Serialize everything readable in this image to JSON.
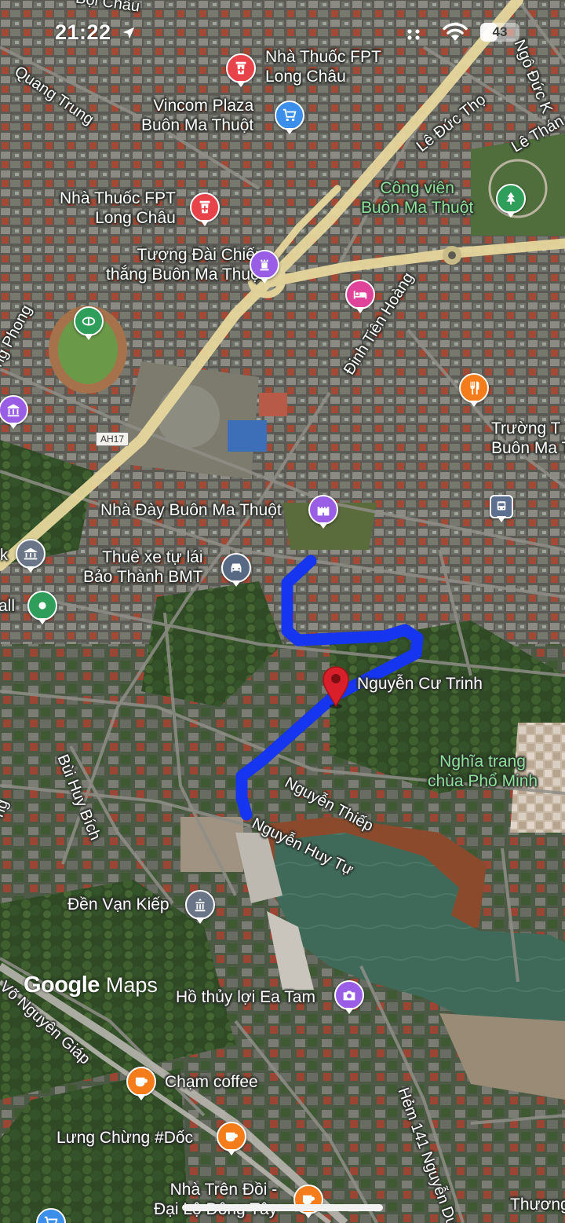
{
  "status_bar": {
    "time": "21:22",
    "battery_level": "43",
    "battery_fraction": 0.43
  },
  "watermark": {
    "google": "Google",
    "maps": "Maps"
  },
  "route": {
    "shield": "AH17",
    "color": "#1a3bff"
  },
  "destination": {
    "label": "Nguyễn Cư Trinh",
    "pin_color": "#d9202a"
  },
  "places": {
    "fpt_top_line1": "Nhà Thuốc FPT",
    "fpt_top_line2": "Long Châu",
    "vincom_line1": "Vincom Plaza",
    "vincom_line2": "Buôn Ma Thuột",
    "fpt_mid_line1": "Nhà Thuốc FPT",
    "fpt_mid_line2": "Long Châu",
    "monument_line1": "Tượng Đài Chiến",
    "monument_line2": "thắng Buôn Ma Thuột",
    "park_line1": "Công viên",
    "park_line2": "Buôn Ma Thuột",
    "school_line1": "Trường T",
    "school_line2": "Buôn Ma Th",
    "prison": "Nhà Đày Buôn Ma Thuột",
    "rental_line1": "Thuê xe tự lái",
    "rental_line2": "Bảo Thành BMT",
    "mall": "all",
    "cemetery_line1": "Nghĩa trang",
    "cemetery_line2": "chùa Phổ Minh",
    "temple": "Đền Vạn Kiếp",
    "lake": "Hồ thủy lợi Ea Tam",
    "cham_coffee": "Chạm coffee",
    "lung_chung": "Lưng Chừng #Dốc",
    "nha_tren_doi_line1": "Nhà Trên Đồi -",
    "nha_tren_doi_line2": "Đại Lộ Đông Tây",
    "thuong": "Thương"
  },
  "streets": {
    "boi_chau": "Bội Châu",
    "quang_trung": "Quang Trung",
    "ngo_duc_ke": "Ngô Đức K",
    "le_duc_tho": "Lê Đức Thọ",
    "le_thanh": "Lê Thán",
    "dinh_tien_hoang": "Đinh Tiên Hoàng",
    "ong_phong": "ng Phong",
    "bui_huy_bich": "Bùi Huy Bích",
    "ong_left": "ng",
    "nguyen_thiep": "Nguyễn Thiếp",
    "nguyen_huy_tu": "Nguyễn Huy Tự",
    "vo_nguyen_giap": "Võ Nguyên Giáp",
    "hem_141": "Hẻm 141 Nguyễn Du",
    "edge_k": "k"
  },
  "icons": {
    "pharmacy": "pharmacy-icon",
    "shopping": "shopping-cart-icon",
    "monument": "monument-icon",
    "hotel": "hotel-bed-icon",
    "stadium": "stadium-icon",
    "museum": "museum-icon",
    "restaurant": "restaurant-icon",
    "bus": "bus-icon",
    "castle": "castle-icon",
    "car": "car-rental-icon",
    "bank": "bank-icon",
    "mall_green": "mall-icon",
    "temple": "temple-icon",
    "camera": "camera-icon",
    "coffee": "coffee-icon",
    "park": "park-tree-icon"
  }
}
